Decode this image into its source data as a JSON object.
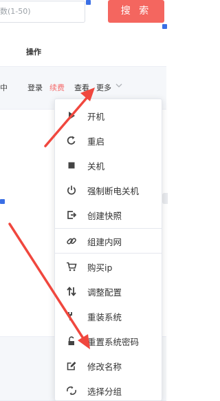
{
  "search": {
    "placeholder_fragment": "数(1-50)",
    "button_label": "搜 索"
  },
  "table": {
    "header_ops": "操作",
    "row1": {
      "fragment": "中",
      "login": "登录",
      "renew": "续费",
      "view": "查看",
      "more": "更多"
    }
  },
  "menu": {
    "items": [
      {
        "label": "开机",
        "icon": "play-icon"
      },
      {
        "label": "重启",
        "icon": "restart-icon"
      },
      {
        "label": "关机",
        "icon": "stop-square-icon"
      },
      {
        "label": "强制断电关机",
        "icon": "power-icon"
      },
      {
        "label": "创建快照",
        "icon": "snapshot-icon"
      },
      {
        "label": "组建内网",
        "icon": "link-icon"
      },
      {
        "label": "购买ip",
        "icon": "cart-icon"
      },
      {
        "label": "调整配置",
        "icon": "swap-arrows-icon"
      },
      {
        "label": "重装系统",
        "icon": "wrench-icon"
      },
      {
        "label": "重置系统密码",
        "icon": "unlock-icon"
      },
      {
        "label": "修改名称",
        "icon": "edit-icon"
      },
      {
        "label": "选择分组",
        "icon": "group-icon"
      }
    ]
  },
  "colors": {
    "accent_red": "#f4665f",
    "renew_red": "#f56c6c",
    "annotation_arrow": "#f0473e",
    "selection_handle": "#3a6fe5"
  }
}
